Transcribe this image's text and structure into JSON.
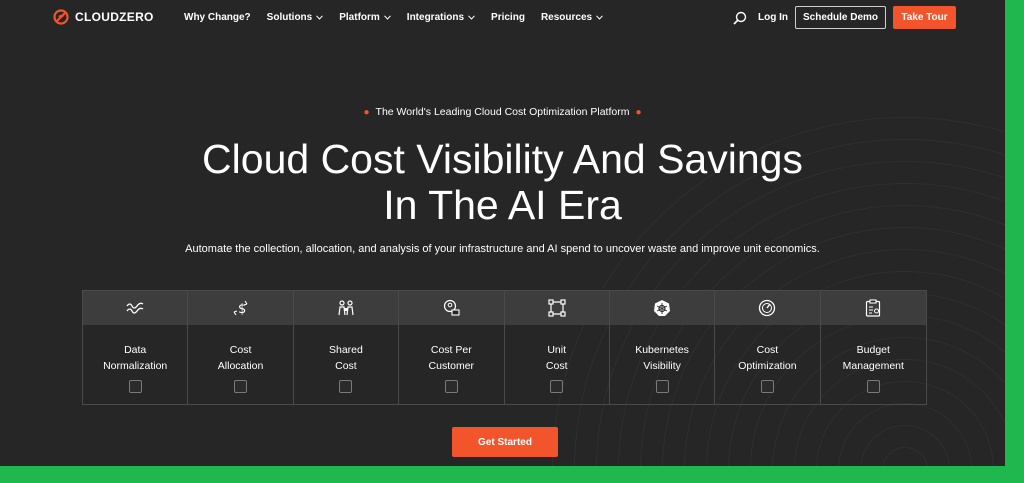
{
  "brand": {
    "name": "CLOUDZERO",
    "accent": "#f2552c",
    "border_color": "#1fb84f"
  },
  "nav": {
    "items": [
      {
        "label": "Why Change?",
        "has_dropdown": false
      },
      {
        "label": "Solutions",
        "has_dropdown": true
      },
      {
        "label": "Platform",
        "has_dropdown": true
      },
      {
        "label": "Integrations",
        "has_dropdown": true
      },
      {
        "label": "Pricing",
        "has_dropdown": false
      },
      {
        "label": "Resources",
        "has_dropdown": true
      }
    ],
    "search_icon": "search-icon",
    "login": "Log In",
    "schedule_demo": "Schedule Demo",
    "take_tour": "Take Tour"
  },
  "hero": {
    "eyebrow": "The World's Leading Cloud Cost Optimization Platform",
    "headline": "Cloud Cost Visibility And Savings\nIn The AI Era",
    "subhead": "Automate the collection, allocation, and analysis of your infrastructure and AI spend to uncover waste and improve unit economics.",
    "cta": "Get Started"
  },
  "features": [
    {
      "icon": "wave-lines-icon",
      "label": "Data\nNormalization",
      "checked": false
    },
    {
      "icon": "dollar-arrows-icon",
      "label": "Cost\nAllocation",
      "checked": false
    },
    {
      "icon": "people-share-icon",
      "label": "Shared\nCost",
      "checked": false
    },
    {
      "icon": "customer-card-icon",
      "label": "Cost Per\nCustomer",
      "checked": false
    },
    {
      "icon": "unit-nodes-icon",
      "label": "Unit\nCost",
      "checked": false
    },
    {
      "icon": "kubernetes-icon",
      "label": "Kubernetes\nVisibility",
      "checked": false
    },
    {
      "icon": "gauge-icon",
      "label": "Cost\nOptimization",
      "checked": false
    },
    {
      "icon": "clipboard-budget-icon",
      "label": "Budget\nManagement",
      "checked": false
    }
  ]
}
